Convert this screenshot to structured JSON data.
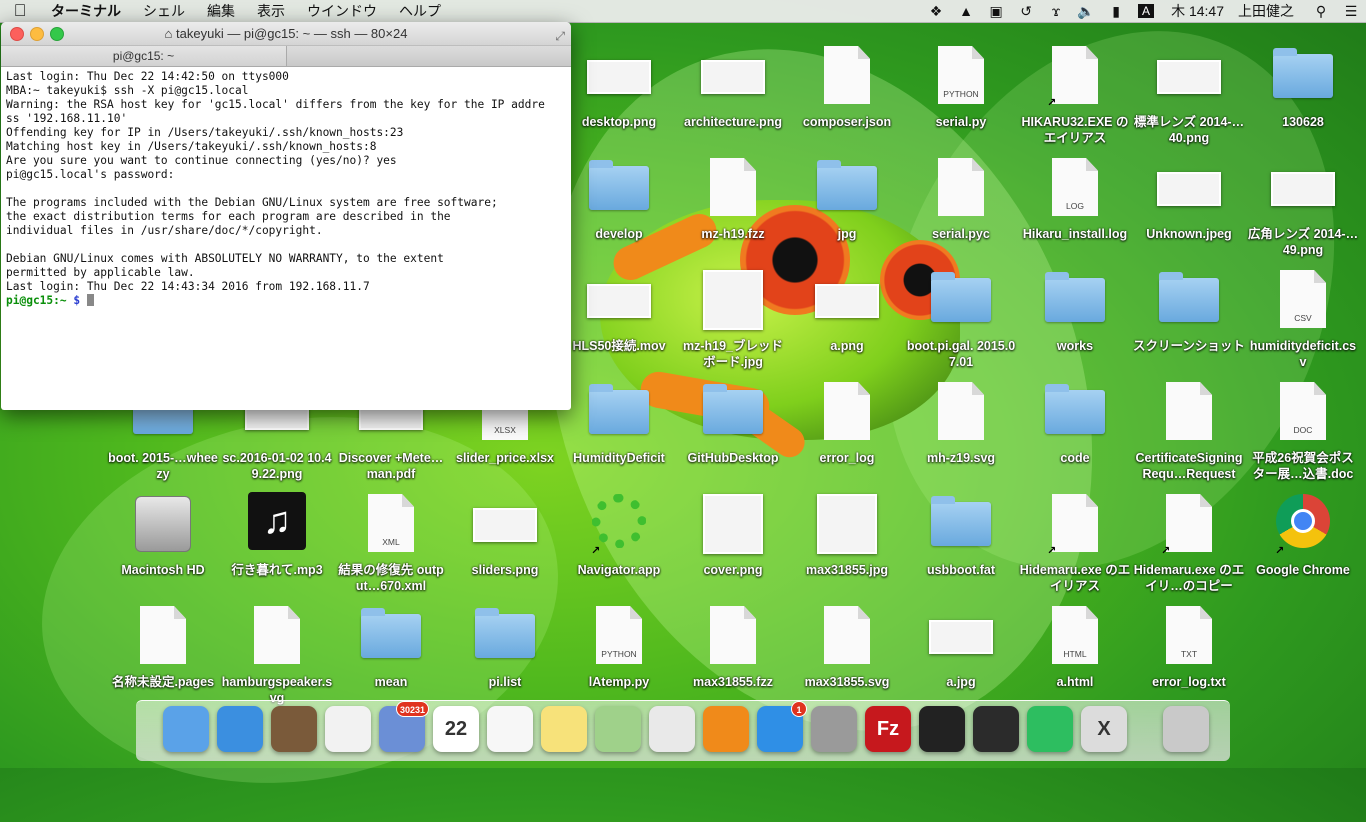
{
  "menubar": {
    "items": [
      "ターミナル",
      "シェル",
      "編集",
      "表示",
      "ウインドウ",
      "ヘルプ"
    ],
    "clock": "木 14:47",
    "user": "上田健之",
    "input_mode": "A"
  },
  "terminal": {
    "title": "takeyuki — pi@gc15: ~ — ssh — 80×24",
    "tab": "pi@gc15: ~",
    "lines": [
      "Last login: Thu Dec 22 14:42:50 on ttys000",
      "MBA:~ takeyuki$ ssh -X pi@gc15.local",
      "Warning: the RSA host key for 'gc15.local' differs from the key for the IP addre",
      "ss '192.168.11.10'",
      "Offending key for IP in /Users/takeyuki/.ssh/known_hosts:23",
      "Matching host key in /Users/takeyuki/.ssh/known_hosts:8",
      "Are you sure you want to continue connecting (yes/no)? yes",
      "pi@gc15.local's password:",
      "",
      "The programs included with the Debian GNU/Linux system are free software;",
      "the exact distribution terms for each program are described in the",
      "individual files in /usr/share/doc/*/copyright.",
      "",
      "Debian GNU/Linux comes with ABSOLUTELY NO WARRANTY, to the extent",
      "permitted by applicable law.",
      "Last login: Thu Dec 22 14:43:34 2016 from 192.168.11.7"
    ],
    "prompt_user": "pi@gc15:~",
    "prompt_symbol": " $ "
  },
  "desktop": {
    "icons": [
      {
        "label": "desktop.png",
        "kind": "thumb"
      },
      {
        "label": "architecture.png",
        "kind": "thumb"
      },
      {
        "label": "composer.json",
        "kind": "doc",
        "tag": ""
      },
      {
        "label": "serial.py",
        "kind": "doc",
        "tag": "PYTHON"
      },
      {
        "label": "HIKARU32.EXE のエイリアス",
        "kind": "doc",
        "tag": "",
        "alias": true
      },
      {
        "label": "標準レンズ 2014-…40.png",
        "kind": "thumb"
      },
      {
        "label": "130628",
        "kind": "folder"
      },
      {
        "label": "develop",
        "kind": "folder"
      },
      {
        "label": "mz-h19.fzz",
        "kind": "doc",
        "tag": ""
      },
      {
        "label": "jpg",
        "kind": "folder"
      },
      {
        "label": "serial.pyc",
        "kind": "doc",
        "tag": ""
      },
      {
        "label": "Hikaru_install.log",
        "kind": "doc",
        "tag": "LOG"
      },
      {
        "label": "Unknown.jpeg",
        "kind": "thumb"
      },
      {
        "label": "広角レンズ 2014-…49.png",
        "kind": "thumb"
      },
      {
        "label": "HLS50接続.mov",
        "kind": "thumb"
      },
      {
        "label": "mz-h19_ブレッドボード.jpg",
        "kind": "thumbsq"
      },
      {
        "label": "a.png",
        "kind": "thumb"
      },
      {
        "label": "boot.pi.gal. 2015.07.01",
        "kind": "folder"
      },
      {
        "label": "works",
        "kind": "folder"
      },
      {
        "label": "スクリーンショット",
        "kind": "folder"
      },
      {
        "label": "humiditydeficit.csv",
        "kind": "doc",
        "tag": "CSV"
      },
      {
        "label": "boot. 2015-…wheezy",
        "kind": "folder"
      },
      {
        "label": "sc.2016-01-02 10.49.22.png",
        "kind": "thumb"
      },
      {
        "label": "Discover +Mete…man.pdf",
        "kind": "thumb"
      },
      {
        "label": "slider_price.xlsx",
        "kind": "doc",
        "tag": "XLSX"
      },
      {
        "label": "HumidityDeficit",
        "kind": "folder"
      },
      {
        "label": "GitHubDesktop",
        "kind": "folder"
      },
      {
        "label": "error_log",
        "kind": "doc",
        "tag": ""
      },
      {
        "label": "mh-z19.svg",
        "kind": "doc",
        "tag": ""
      },
      {
        "label": "code",
        "kind": "folder"
      },
      {
        "label": "CertificateSigningRequ…Request",
        "kind": "doc",
        "tag": ""
      },
      {
        "label": "平成26祝賀会ポスター展…込書.doc",
        "kind": "doc",
        "tag": "DOC"
      },
      {
        "label": "Macintosh HD",
        "kind": "hdd"
      },
      {
        "label": "行き暮れて.mp3",
        "kind": "music"
      },
      {
        "label": "結果の修復先 output…670.xml",
        "kind": "doc",
        "tag": "XML"
      },
      {
        "label": "sliders.png",
        "kind": "thumb"
      },
      {
        "label": "Navigator.app",
        "kind": "ring",
        "alias": true
      },
      {
        "label": "cover.png",
        "kind": "thumbsq"
      },
      {
        "label": "max31855.jpg",
        "kind": "thumbsq"
      },
      {
        "label": "usbboot.fat",
        "kind": "folder"
      },
      {
        "label": "Hidemaru.exe のエイリアス",
        "kind": "doc",
        "tag": "",
        "alias": true
      },
      {
        "label": "Hidemaru.exe のエイリ…のコピー",
        "kind": "doc",
        "tag": "",
        "alias": true
      },
      {
        "label": "Google Chrome",
        "kind": "chrome",
        "alias": true
      },
      {
        "label": "名称未設定.pages",
        "kind": "doc",
        "tag": ""
      },
      {
        "label": "hamburgspeaker.svg",
        "kind": "doc",
        "tag": ""
      },
      {
        "label": "mean",
        "kind": "folder"
      },
      {
        "label": "pi.list",
        "kind": "folder"
      },
      {
        "label": "lAtemp.py",
        "kind": "doc",
        "tag": "PYTHON"
      },
      {
        "label": "max31855.fzz",
        "kind": "doc",
        "tag": ""
      },
      {
        "label": "max31855.svg",
        "kind": "doc",
        "tag": ""
      },
      {
        "label": "a.jpg",
        "kind": "thumb"
      },
      {
        "label": "a.html",
        "kind": "doc",
        "tag": "HTML"
      },
      {
        "label": "error_log.txt",
        "kind": "doc",
        "tag": "TXT"
      }
    ]
  },
  "dock": {
    "items": [
      {
        "name": "finder-icon",
        "color": "#5aa2e8"
      },
      {
        "name": "safari-icon",
        "color": "#3b8fe0"
      },
      {
        "name": "photo-app-icon",
        "color": "#7a5a3a"
      },
      {
        "name": "launchpad-icon",
        "color": "#f2f2f2"
      },
      {
        "name": "mail-icon",
        "color": "#6b8fd6",
        "badge": "30231"
      },
      {
        "name": "calendar-icon",
        "color": "#ffffff",
        "text": "22"
      },
      {
        "name": "reminders-icon",
        "color": "#f7f7f7"
      },
      {
        "name": "stickies-icon",
        "color": "#f7e27a"
      },
      {
        "name": "maps-icon",
        "color": "#9fd18a"
      },
      {
        "name": "chrome-icon",
        "color": "#e9e9e9"
      },
      {
        "name": "ibooks-icon",
        "color": "#f08a1a"
      },
      {
        "name": "app-store-icon",
        "color": "#2f8fe6",
        "badge": "1"
      },
      {
        "name": "system-preferences-icon",
        "color": "#9a9a9a"
      },
      {
        "name": "filezilla-icon",
        "color": "#c6181d",
        "text": "Fz"
      },
      {
        "name": "terminal-icon",
        "color": "#222222"
      },
      {
        "name": "activity-monitor-icon",
        "color": "#2b2b2b"
      },
      {
        "name": "evernote-icon",
        "color": "#2dbe60"
      },
      {
        "name": "x11-icon",
        "color": "#dcdcdc",
        "text": "X"
      },
      {
        "name": "trash-icon",
        "color": "#c9c9c9"
      }
    ]
  }
}
